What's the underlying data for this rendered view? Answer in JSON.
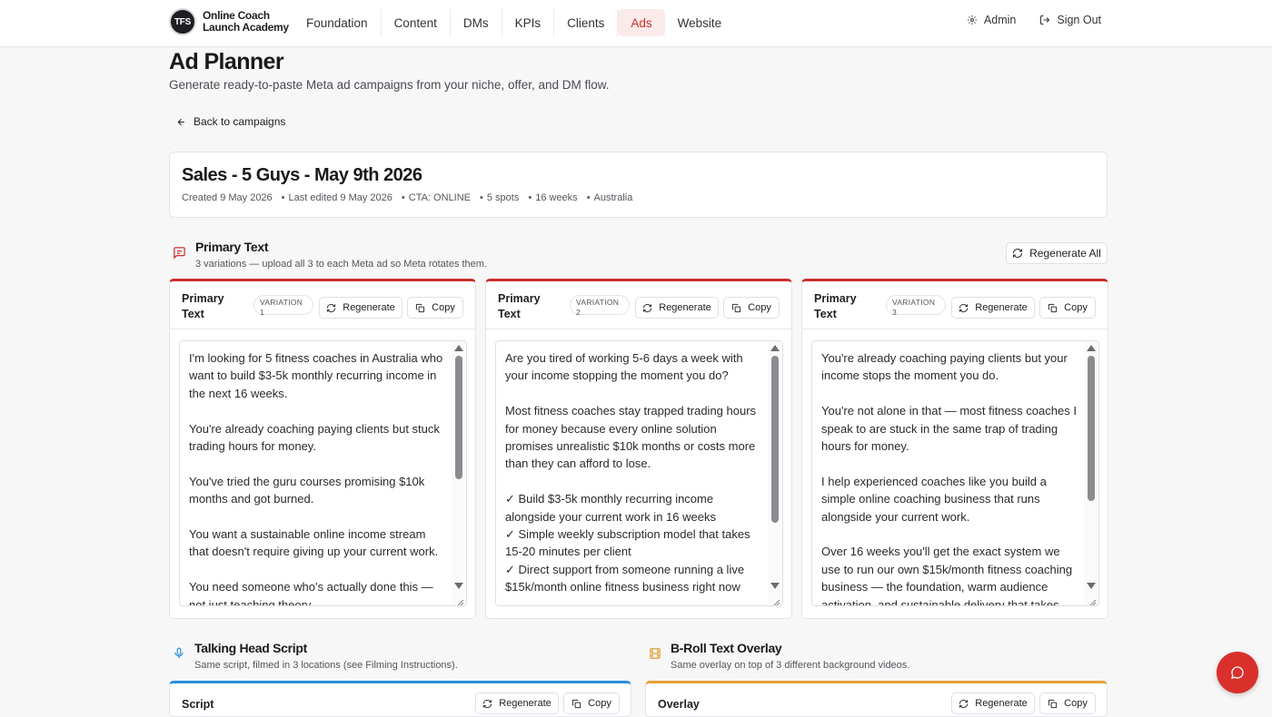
{
  "brand": {
    "logo_badge": "TFS",
    "name_line1": "Online Coach",
    "name_line2": "Launch Academy"
  },
  "nav": [
    {
      "label": "Foundation",
      "active": false
    },
    {
      "label": "Content",
      "active": false
    },
    {
      "label": "DMs",
      "active": false
    },
    {
      "label": "KPIs",
      "active": false
    },
    {
      "label": "Clients",
      "active": false
    },
    {
      "label": "Ads",
      "active": true
    },
    {
      "label": "Website",
      "active": false
    }
  ],
  "header_right": {
    "admin_label": "Admin",
    "signout_label": "Sign Out"
  },
  "page": {
    "title": "Ad Planner",
    "subtitle": "Generate ready-to-paste Meta ad campaigns from your niche, offer, and DM flow.",
    "back_label": "Back to campaigns"
  },
  "campaign": {
    "title": "Sales - 5 Guys - May 9th 2026",
    "created": "Created 9 May 2026",
    "edited": "Last edited 9 May 2026",
    "cta": "CTA: ONLINE",
    "spots": "5 spots",
    "weeks": "16 weeks",
    "location": "Australia"
  },
  "primary_section": {
    "title": "Primary Text",
    "subtitle": "3 variations — upload all 3 to each Meta ad so Meta rotates them.",
    "regen_all_label": "Regenerate All"
  },
  "variations": [
    {
      "label": "Primary Text",
      "pill_label": "VARIATION",
      "pill_num": "1",
      "regen_label": "Regenerate",
      "copy_label": "Copy",
      "text": "I'm looking for 5 fitness coaches in Australia who want to build $3-5k monthly recurring income in the next 16 weeks.\n\nYou're already coaching paying clients but stuck trading hours for money.\n\nYou've tried the guru courses promising $10k months and got burned.\n\nYou want a sustainable online income stream that doesn't require giving up your current work.\n\nYou need someone who's actually done this — not just teaching theory."
    },
    {
      "label": "Primary Text",
      "pill_label": "VARIATION",
      "pill_num": "2",
      "regen_label": "Regenerate",
      "copy_label": "Copy",
      "text": "Are you tired of working 5-6 days a week with your income stopping the moment you do?\n\nMost fitness coaches stay trapped trading hours for money because every online solution promises unrealistic $10k months or costs more than they can afford to lose.\n\n✓ Build $3-5k monthly recurring income alongside your current work in 16 weeks\n✓ Simple weekly subscription model that takes 15-20 minutes per client\n✓ Direct support from someone running a live $15k/month online fitness business right now"
    },
    {
      "label": "Primary Text",
      "pill_label": "VARIATION",
      "pill_num": "3",
      "regen_label": "Regenerate",
      "copy_label": "Copy",
      "text": "You're already coaching paying clients but your income stops the moment you do.\n\nYou're not alone in that — most fitness coaches I speak to are stuck in the same trap of trading hours for money.\n\nI help experienced coaches like you build a simple online coaching business that runs alongside your current work.\n\nOver 16 weeks you'll get the exact system we use to run our own $15k/month fitness coaching business — the foundation, warm audience activation, and sustainable delivery that takes just"
    }
  ],
  "script_section": {
    "title": "Talking Head Script",
    "subtitle": "Same script, filmed in 3 locations (see Filming Instructions).",
    "card_label": "Script",
    "regen_label": "Regenerate",
    "copy_label": "Copy",
    "accent": "#2b8fd6"
  },
  "broll_section": {
    "title": "B-Roll Text Overlay",
    "subtitle": "Same overlay on top of 3 different background videos.",
    "card_label": "Overlay",
    "regen_label": "Regenerate",
    "copy_label": "Copy",
    "accent": "#e2a23a"
  },
  "colors": {
    "brand_red": "#c9302c",
    "fab_red": "#d9302c",
    "active_nav_bg": "#fbeaea"
  },
  "icons": {
    "admin": "gear-icon",
    "signout": "logout-icon",
    "back": "arrow-left-icon",
    "primary_section": "message-square-icon",
    "regenerate": "refresh-icon",
    "copy": "copy-icon",
    "script_section": "microphone-icon",
    "broll_section": "film-icon",
    "chat": "chat-bubble-icon"
  }
}
